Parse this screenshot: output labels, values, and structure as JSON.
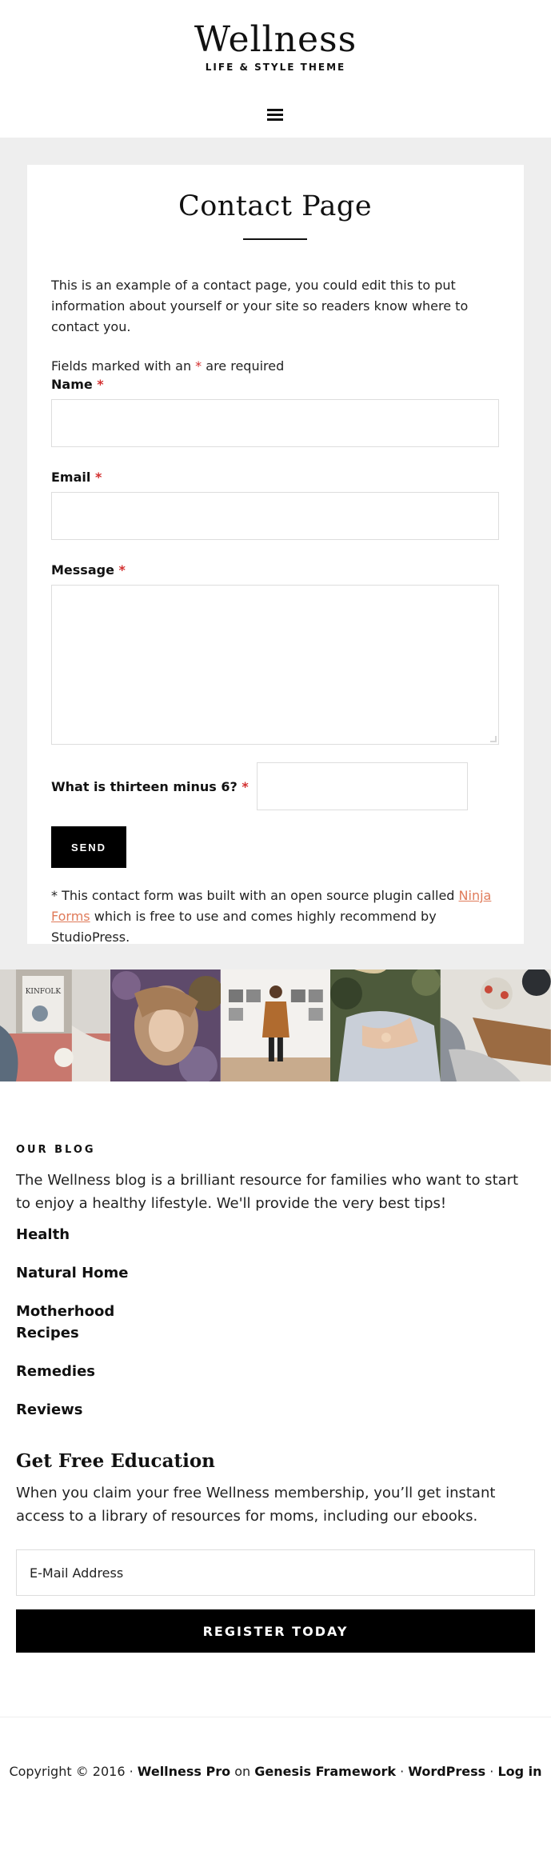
{
  "header": {
    "site_title": "Wellness",
    "site_description": "LIFE & STYLE THEME",
    "menu_icon": "hamburger-menu-icon"
  },
  "page": {
    "title": "Contact Page",
    "intro": "This is an example of a contact page, you could edit this to put information about yourself or your site so readers know where to contact you.",
    "required_note_pre": "Fields marked with an ",
    "required_star": "*",
    "required_note_post": " are required"
  },
  "form": {
    "name_label": "Name",
    "email_label": "Email",
    "message_label": "Message",
    "captcha_label": "What is thirteen minus 6?",
    "send_label": "SEND",
    "footnote_pre": "* This contact form was built with an open source plugin called ",
    "footnote_link": "Ninja Forms",
    "footnote_post": " which is free to use and comes highly recommend by StudioPress."
  },
  "gallery": {
    "images": [
      "magazine-reader",
      "woman-in-flowers",
      "gallery-visitor",
      "hands-on-dress",
      "table-setting"
    ]
  },
  "blog": {
    "heading": "OUR BLOG",
    "text": "The Wellness blog is a brilliant resource for families who want to start to enjoy a healthy lifestyle. We'll provide the very best tips!",
    "categories": [
      "Health",
      "Natural Home",
      "Motherhood",
      "Recipes",
      "Remedies",
      "Reviews"
    ]
  },
  "education": {
    "title": "Get Free Education",
    "text": "When you claim your free Wellness membership, you’ll get instant access to a library of resources for moms, including our ebooks.",
    "email_placeholder": "E-Mail Address",
    "button_label": "REGISTER TODAY"
  },
  "footer": {
    "copyright": "Copyright © 2016 · ",
    "theme": "Wellness Pro",
    "on": " on ",
    "framework": "Genesis Framework",
    "sep": " · ",
    "wordpress": "WordPress",
    "login": "Log in"
  },
  "colors": {
    "accent": "#e07b5a",
    "required": "#d32f2f",
    "content_bg": "#eeeeee"
  }
}
